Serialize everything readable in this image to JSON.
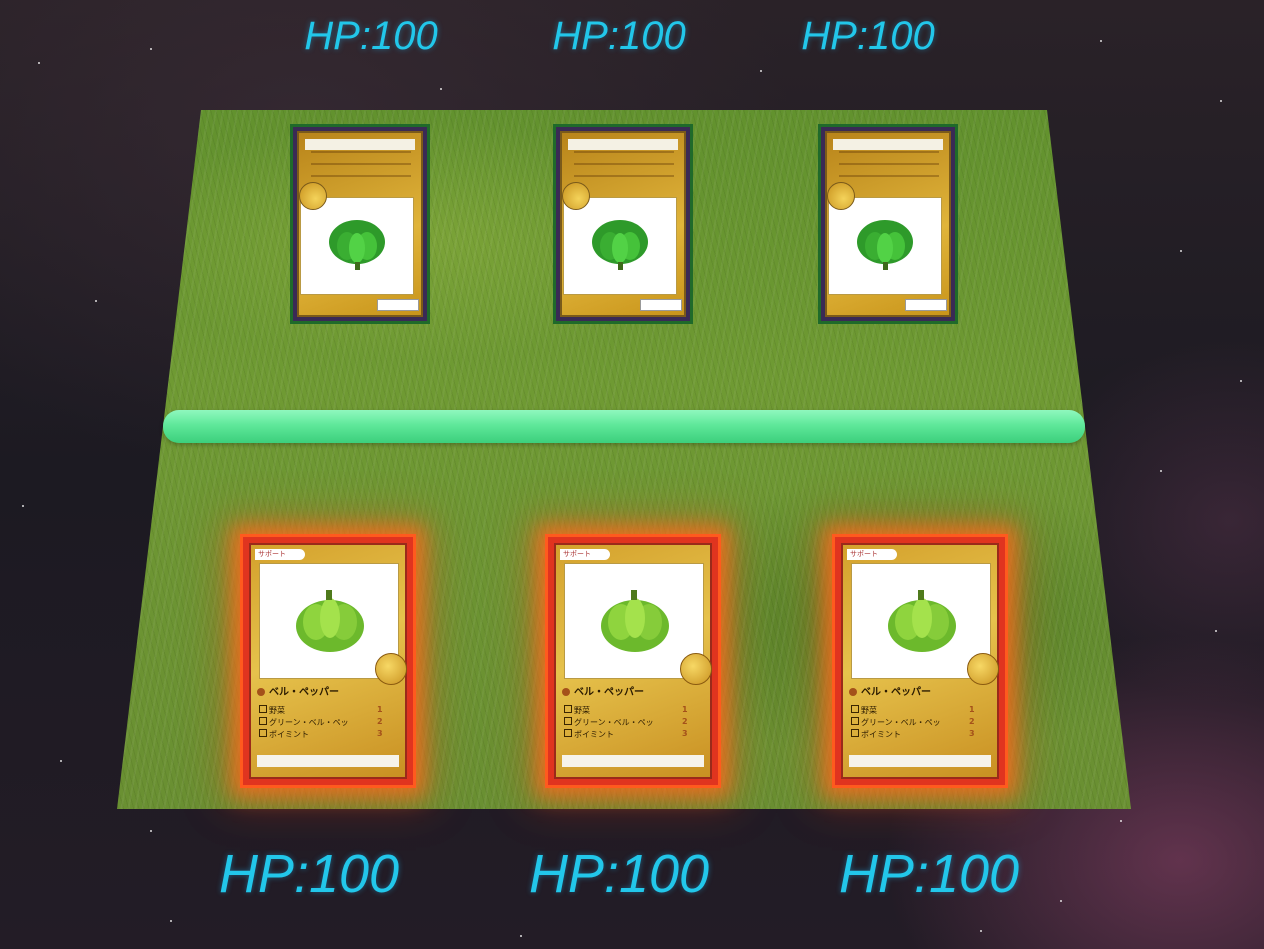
{
  "opponent": {
    "hp_labels": [
      "HP:100",
      "HP:100",
      "HP:100"
    ]
  },
  "player": {
    "hp_labels": [
      "HP:100",
      "HP:100",
      "HP:100"
    ],
    "cards": [
      {
        "badge": "サポート",
        "name": "ベル・ペッパー",
        "rows": [
          "野菜",
          "グリーン・ベル・ペッ",
          "ポイミント"
        ],
        "vals": [
          "1",
          "2",
          "3"
        ]
      },
      {
        "badge": "サポート",
        "name": "ベル・ペッパー",
        "rows": [
          "野菜",
          "グリーン・ベル・ペッ",
          "ポイミント"
        ],
        "vals": [
          "1",
          "2",
          "3"
        ]
      },
      {
        "badge": "サポート",
        "name": "ベル・ペッパー",
        "rows": [
          "野菜",
          "グリーン・ベル・ペッ",
          "ポイミント"
        ],
        "vals": [
          "1",
          "2",
          "3"
        ]
      }
    ]
  },
  "colors": {
    "hp_text": "#22c7ea",
    "divider": "#5fe89a",
    "field_grass": "#6f9a33",
    "player_card_glow": "#ff5a1e",
    "opponent_card_gold": "#e0b43a"
  },
  "icons": {
    "card_art": "bell-pepper-icon",
    "card_emblem": "badge-emblem-icon"
  }
}
